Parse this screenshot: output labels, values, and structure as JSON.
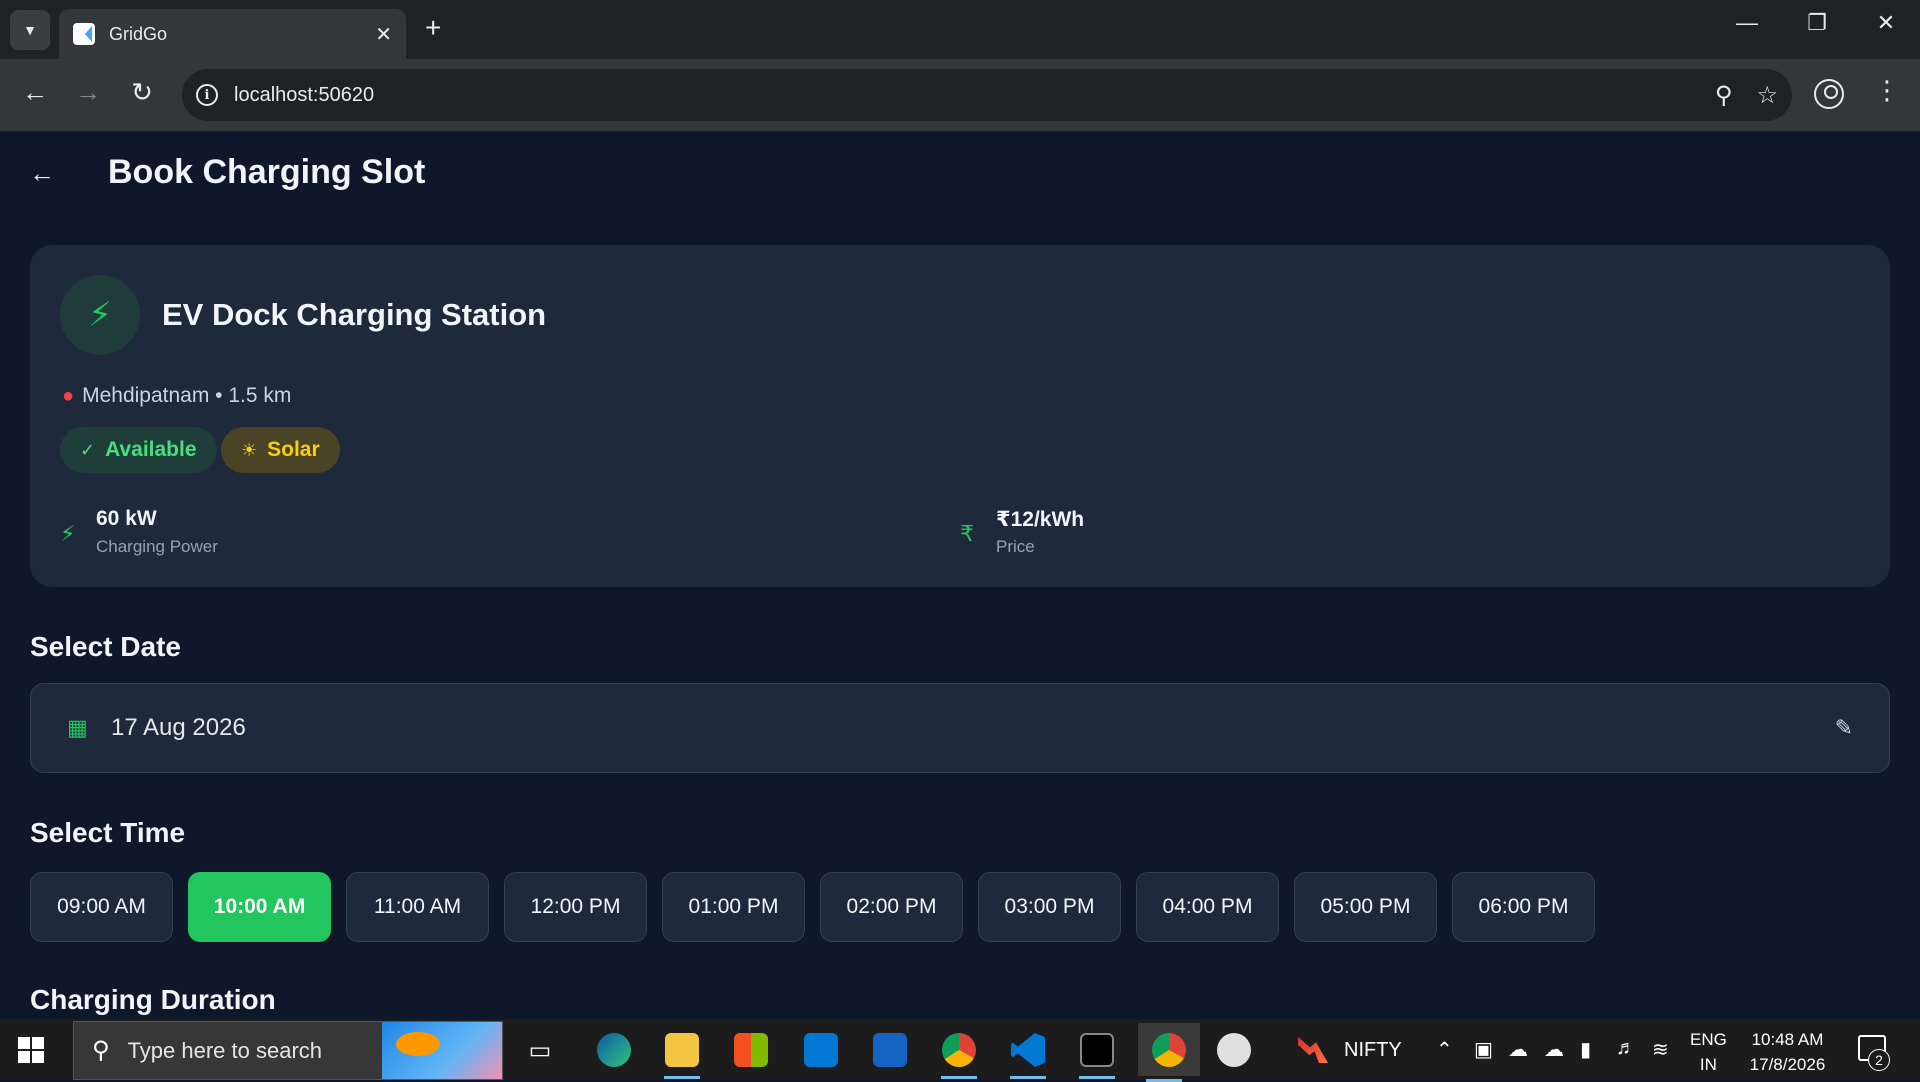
{
  "browser": {
    "tab_title": "GridGo",
    "url": "localhost:50620",
    "icons": {
      "tab_search": "chevron-down-icon",
      "close_tab": "close-icon",
      "new_tab": "plus-icon",
      "minimize": "minimize-icon",
      "restore": "restore-icon",
      "close_window": "close-icon",
      "back": "arrow-left-icon",
      "forward": "arrow-right-icon",
      "reload": "reload-icon",
      "site_info": "info-icon",
      "location": "location-pin-icon",
      "bookmark": "star-icon",
      "profile": "profile-icon",
      "menu": "kebab-menu-icon"
    }
  },
  "app": {
    "header": {
      "title": "Book Charging Slot",
      "back_icon": "back-icon"
    },
    "station": {
      "name": "EV Dock Charging Station",
      "location": "Mehdipatnam • 1.5 km",
      "badges": [
        {
          "label": "Available",
          "color": "#4ade80"
        },
        {
          "label": "Solar",
          "color": "#facc15"
        }
      ],
      "stats": [
        {
          "value": "60 kW",
          "label": "Charging Power",
          "icon": "bolt-icon"
        },
        {
          "value": "₹12/kWh",
          "label": "Price",
          "icon": "currency-icon"
        }
      ]
    },
    "date_section": {
      "title": "Select Date",
      "value": "17 Aug 2026"
    },
    "time_section": {
      "title": "Select Time",
      "slots": [
        "09:00 AM",
        "10:00 AM",
        "11:00 AM",
        "12:00 PM",
        "01:00 PM",
        "02:00 PM",
        "03:00 PM",
        "04:00 PM",
        "05:00 PM",
        "06:00 PM"
      ],
      "selected": "10:00 AM"
    },
    "duration_section": {
      "title": "Charging Duration"
    },
    "colors": {
      "accent": "#22c55e",
      "background": "#0f172a",
      "card": "#1e293b"
    }
  },
  "taskbar": {
    "search_placeholder": "Type here to search",
    "ticker": "NIFTY",
    "language_line1": "ENG",
    "language_line2": "IN",
    "time": "10:48 AM",
    "date": "17/8/2026",
    "notification_count": "2"
  }
}
